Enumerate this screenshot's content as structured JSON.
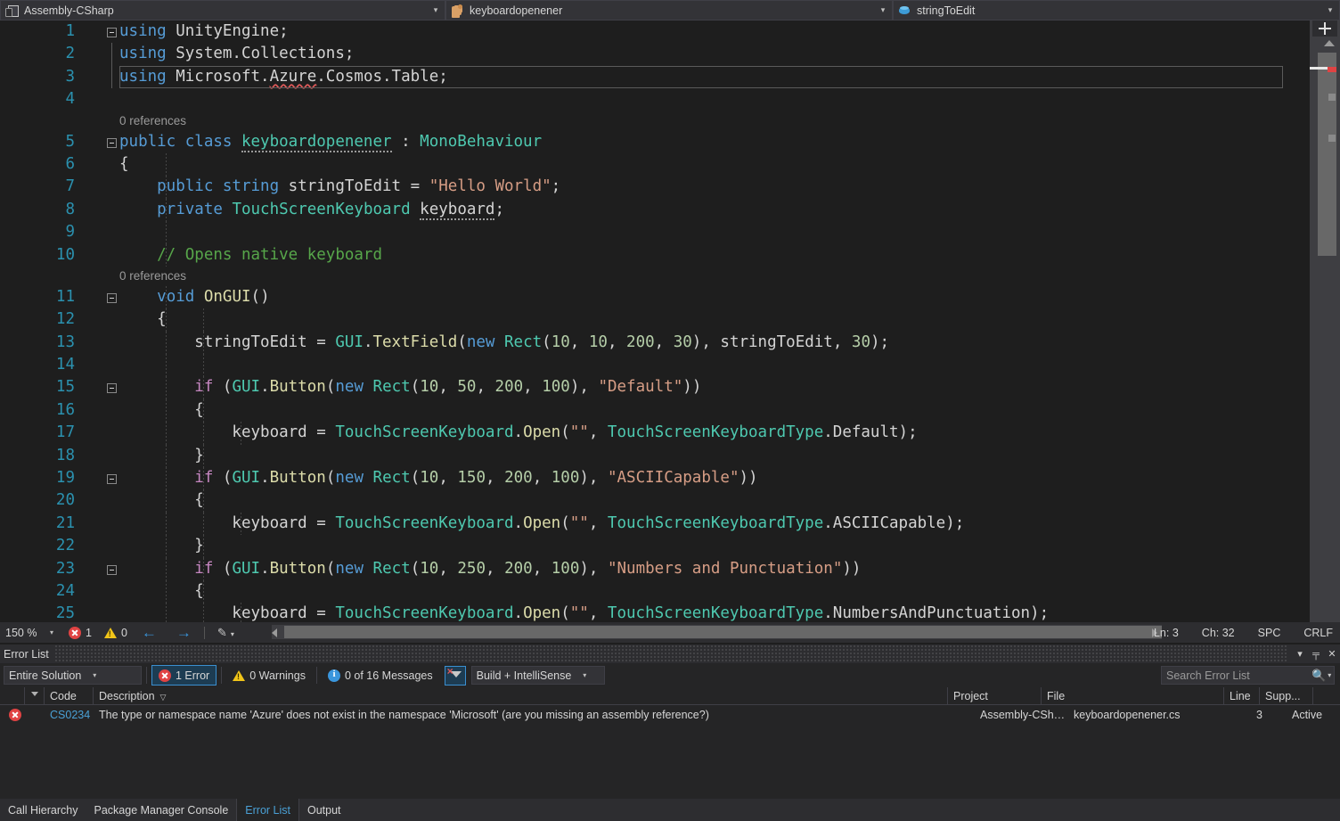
{
  "navbar": {
    "project": {
      "label": "Assembly-CSharp",
      "icon": "project-icon",
      "arrow": "▾"
    },
    "type": {
      "label": "keyboardopenener",
      "icon": "class-icon",
      "arrow": "▾"
    },
    "member": {
      "label": "stringToEdit",
      "icon": "field-icon",
      "arrow": "▾"
    }
  },
  "editor": {
    "lines": [
      {
        "no": "1",
        "tokens": [
          {
            "t": "using ",
            "c": "kw"
          },
          {
            "t": "UnityEngine",
            "c": "ns"
          },
          {
            "t": ";",
            "c": "pln"
          }
        ]
      },
      {
        "no": "2",
        "tokens": [
          {
            "t": "using ",
            "c": "kw"
          },
          {
            "t": "System.Collections",
            "c": "ns"
          },
          {
            "t": ";",
            "c": "pln"
          }
        ]
      },
      {
        "no": "3",
        "tokens": [
          {
            "t": "using ",
            "c": "kw"
          },
          {
            "t": "Microsoft.",
            "c": "ns"
          },
          {
            "t": "Azure",
            "c": "ns squiggle"
          },
          {
            "t": ".Cosmos.Table;",
            "c": "ns"
          }
        ]
      },
      {
        "no": "4",
        "tokens": []
      },
      {
        "no": "5",
        "tokens": [
          {
            "t": "public class ",
            "c": "kw"
          },
          {
            "t": "keyboardopenener",
            "c": "typ dots"
          },
          {
            "t": " : ",
            "c": "pln"
          },
          {
            "t": "MonoBehaviour",
            "c": "typ"
          }
        ]
      },
      {
        "no": "6",
        "tokens": [
          {
            "t": "{",
            "c": "pln"
          }
        ]
      },
      {
        "no": "7",
        "tokens": [
          {
            "t": "    public string ",
            "c": "kw"
          },
          {
            "t": "stringToEdit",
            "c": "pln"
          },
          {
            "t": " = ",
            "c": "pln"
          },
          {
            "t": "\"Hello World\"",
            "c": "str"
          },
          {
            "t": ";",
            "c": "pln"
          }
        ]
      },
      {
        "no": "8",
        "tokens": [
          {
            "t": "    private ",
            "c": "kw"
          },
          {
            "t": "TouchScreenKeyboard",
            "c": "typ"
          },
          {
            "t": " ",
            "c": "pln"
          },
          {
            "t": "keyboard",
            "c": "pln dots"
          },
          {
            "t": ";",
            "c": "pln"
          }
        ]
      },
      {
        "no": "9",
        "tokens": []
      },
      {
        "no": "10",
        "tokens": [
          {
            "t": "    // Opens native keyboard",
            "c": "cmt"
          }
        ]
      },
      {
        "no": "11",
        "tokens": [
          {
            "t": "    ",
            "c": "pln"
          },
          {
            "t": "void ",
            "c": "kw"
          },
          {
            "t": "OnGUI",
            "c": "fn"
          },
          {
            "t": "()",
            "c": "pln"
          }
        ]
      },
      {
        "no": "12",
        "tokens": [
          {
            "t": "    {",
            "c": "pln"
          }
        ]
      },
      {
        "no": "13",
        "tokens": [
          {
            "t": "        stringToEdit = ",
            "c": "pln"
          },
          {
            "t": "GUI",
            "c": "typ"
          },
          {
            "t": ".",
            "c": "pln"
          },
          {
            "t": "TextField",
            "c": "fn"
          },
          {
            "t": "(",
            "c": "pln"
          },
          {
            "t": "new ",
            "c": "kw"
          },
          {
            "t": "Rect",
            "c": "typ"
          },
          {
            "t": "(",
            "c": "pln"
          },
          {
            "t": "10",
            "c": "num"
          },
          {
            "t": ", ",
            "c": "pln"
          },
          {
            "t": "10",
            "c": "num"
          },
          {
            "t": ", ",
            "c": "pln"
          },
          {
            "t": "200",
            "c": "num"
          },
          {
            "t": ", ",
            "c": "pln"
          },
          {
            "t": "30",
            "c": "num"
          },
          {
            "t": "), stringToEdit, ",
            "c": "pln"
          },
          {
            "t": "30",
            "c": "num"
          },
          {
            "t": ");",
            "c": "pln"
          }
        ]
      },
      {
        "no": "14",
        "tokens": []
      },
      {
        "no": "15",
        "tokens": [
          {
            "t": "        ",
            "c": "pln"
          },
          {
            "t": "if ",
            "c": "kwc"
          },
          {
            "t": "(",
            "c": "pln"
          },
          {
            "t": "GUI",
            "c": "typ"
          },
          {
            "t": ".",
            "c": "pln"
          },
          {
            "t": "Button",
            "c": "fn"
          },
          {
            "t": "(",
            "c": "pln"
          },
          {
            "t": "new ",
            "c": "kw"
          },
          {
            "t": "Rect",
            "c": "typ"
          },
          {
            "t": "(",
            "c": "pln"
          },
          {
            "t": "10",
            "c": "num"
          },
          {
            "t": ", ",
            "c": "pln"
          },
          {
            "t": "50",
            "c": "num"
          },
          {
            "t": ", ",
            "c": "pln"
          },
          {
            "t": "200",
            "c": "num"
          },
          {
            "t": ", ",
            "c": "pln"
          },
          {
            "t": "100",
            "c": "num"
          },
          {
            "t": "), ",
            "c": "pln"
          },
          {
            "t": "\"Default\"",
            "c": "str"
          },
          {
            "t": "))",
            "c": "pln"
          }
        ]
      },
      {
        "no": "16",
        "tokens": [
          {
            "t": "        {",
            "c": "pln"
          }
        ]
      },
      {
        "no": "17",
        "tokens": [
          {
            "t": "            keyboard = ",
            "c": "pln"
          },
          {
            "t": "TouchScreenKeyboard",
            "c": "typ"
          },
          {
            "t": ".",
            "c": "pln"
          },
          {
            "t": "Open",
            "c": "fn"
          },
          {
            "t": "(",
            "c": "pln"
          },
          {
            "t": "\"\"",
            "c": "str"
          },
          {
            "t": ", ",
            "c": "pln"
          },
          {
            "t": "TouchScreenKeyboardType",
            "c": "typ"
          },
          {
            "t": ".Default);",
            "c": "pln"
          }
        ]
      },
      {
        "no": "18",
        "tokens": [
          {
            "t": "        }",
            "c": "pln"
          }
        ]
      },
      {
        "no": "19",
        "tokens": [
          {
            "t": "        ",
            "c": "pln"
          },
          {
            "t": "if ",
            "c": "kwc"
          },
          {
            "t": "(",
            "c": "pln"
          },
          {
            "t": "GUI",
            "c": "typ"
          },
          {
            "t": ".",
            "c": "pln"
          },
          {
            "t": "Button",
            "c": "fn"
          },
          {
            "t": "(",
            "c": "pln"
          },
          {
            "t": "new ",
            "c": "kw"
          },
          {
            "t": "Rect",
            "c": "typ"
          },
          {
            "t": "(",
            "c": "pln"
          },
          {
            "t": "10",
            "c": "num"
          },
          {
            "t": ", ",
            "c": "pln"
          },
          {
            "t": "150",
            "c": "num"
          },
          {
            "t": ", ",
            "c": "pln"
          },
          {
            "t": "200",
            "c": "num"
          },
          {
            "t": ", ",
            "c": "pln"
          },
          {
            "t": "100",
            "c": "num"
          },
          {
            "t": "), ",
            "c": "pln"
          },
          {
            "t": "\"ASCIICapable\"",
            "c": "str"
          },
          {
            "t": "))",
            "c": "pln"
          }
        ]
      },
      {
        "no": "20",
        "tokens": [
          {
            "t": "        {",
            "c": "pln"
          }
        ]
      },
      {
        "no": "21",
        "tokens": [
          {
            "t": "            keyboard = ",
            "c": "pln"
          },
          {
            "t": "TouchScreenKeyboard",
            "c": "typ"
          },
          {
            "t": ".",
            "c": "pln"
          },
          {
            "t": "Open",
            "c": "fn"
          },
          {
            "t": "(",
            "c": "pln"
          },
          {
            "t": "\"\"",
            "c": "str"
          },
          {
            "t": ", ",
            "c": "pln"
          },
          {
            "t": "TouchScreenKeyboardType",
            "c": "typ"
          },
          {
            "t": ".ASCIICapable);",
            "c": "pln"
          }
        ]
      },
      {
        "no": "22",
        "tokens": [
          {
            "t": "        }",
            "c": "pln"
          }
        ]
      },
      {
        "no": "23",
        "tokens": [
          {
            "t": "        ",
            "c": "pln"
          },
          {
            "t": "if ",
            "c": "kwc"
          },
          {
            "t": "(",
            "c": "pln"
          },
          {
            "t": "GUI",
            "c": "typ"
          },
          {
            "t": ".",
            "c": "pln"
          },
          {
            "t": "Button",
            "c": "fn"
          },
          {
            "t": "(",
            "c": "pln"
          },
          {
            "t": "new ",
            "c": "kw"
          },
          {
            "t": "Rect",
            "c": "typ"
          },
          {
            "t": "(",
            "c": "pln"
          },
          {
            "t": "10",
            "c": "num"
          },
          {
            "t": ", ",
            "c": "pln"
          },
          {
            "t": "250",
            "c": "num"
          },
          {
            "t": ", ",
            "c": "pln"
          },
          {
            "t": "200",
            "c": "num"
          },
          {
            "t": ", ",
            "c": "pln"
          },
          {
            "t": "100",
            "c": "num"
          },
          {
            "t": "), ",
            "c": "pln"
          },
          {
            "t": "\"Numbers and Punctuation\"",
            "c": "str"
          },
          {
            "t": "))",
            "c": "pln"
          }
        ]
      },
      {
        "no": "24",
        "tokens": [
          {
            "t": "        {",
            "c": "pln"
          }
        ]
      },
      {
        "no": "25",
        "tokens": [
          {
            "t": "            keyboard = ",
            "c": "pln"
          },
          {
            "t": "TouchScreenKeyboard",
            "c": "typ"
          },
          {
            "t": ".",
            "c": "pln"
          },
          {
            "t": "Open",
            "c": "fn"
          },
          {
            "t": "(",
            "c": "pln"
          },
          {
            "t": "\"\"",
            "c": "str"
          },
          {
            "t": ", ",
            "c": "pln"
          },
          {
            "t": "TouchScreenKeyboardType",
            "c": "typ"
          },
          {
            "t": ".NumbersAndPunctuation);",
            "c": "pln"
          }
        ]
      }
    ],
    "codelens_class": "0 references",
    "codelens_method": "0 references"
  },
  "statusbar": {
    "zoom": "150 %",
    "zoom_arrow": "▾",
    "error_count": "1",
    "warning_count": "0",
    "prev_arrow": "←",
    "next_arrow": "→",
    "brush_arrow": "▾",
    "line": "Ln: 3",
    "column": "Ch: 32",
    "spaces": "SPC",
    "eol": "CRLF"
  },
  "panel": {
    "title": "Error List",
    "menu_glyph": "▾",
    "pin_glyph": "╤",
    "close_glyph": "✕",
    "scope_filter": "Entire Solution",
    "errors_label": "1 Error",
    "warnings_label": "0 Warnings",
    "messages_label": "0 of 16 Messages",
    "build_filter": "Build + IntelliSense",
    "search_placeholder": "Search Error List",
    "search_value": "",
    "search_icon": "🔍",
    "search_arrow": "▾",
    "columns": {
      "code": "Code",
      "description": "Description",
      "project": "Project",
      "file": "File",
      "line": "Line",
      "suppression": "Supp...",
      "sort_caret": "▽"
    },
    "rows": [
      {
        "severity": "error",
        "code": "CS0234",
        "description": "The type or namespace name 'Azure' does not exist in the namespace 'Microsoft' (are you missing an assembly reference?)",
        "project": "Assembly-CShar...",
        "file": "keyboardopenener.cs",
        "line": "3",
        "suppression": "Active"
      }
    ]
  },
  "bottom_tabs": [
    {
      "label": "Call Hierarchy",
      "selected": false
    },
    {
      "label": "Package Manager Console",
      "selected": false
    },
    {
      "label": "Error List",
      "selected": true
    },
    {
      "label": "Output",
      "selected": false
    }
  ],
  "colors": {
    "accent": "#3a96dd",
    "error": "#e04343",
    "warning": "#f0c419",
    "link": "#4aa0d5",
    "editor_bg": "#1e1e1e",
    "chrome_bg": "#2d2d30"
  }
}
